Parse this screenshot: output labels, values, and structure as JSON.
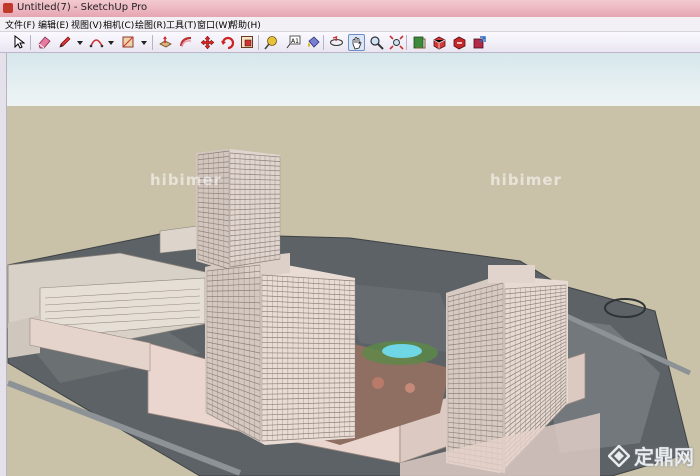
{
  "window": {
    "title": "Untitled(7) - SketchUp Pro"
  },
  "menus": [
    "文件(F)",
    "编辑(E)",
    "视图(V)",
    "相机(C)",
    "绘图(R)",
    "工具(T)",
    "窗口(W)",
    "帮助(H)"
  ],
  "watermarks": {
    "left": "hibimer",
    "right": "hibimer"
  },
  "logo": {
    "text": "定鼎网"
  },
  "colors": {
    "titlebar": "#e6a6b2",
    "ground": "#c9c2a8",
    "sky": "#e9f1f3",
    "building": "#e3d9d2"
  }
}
